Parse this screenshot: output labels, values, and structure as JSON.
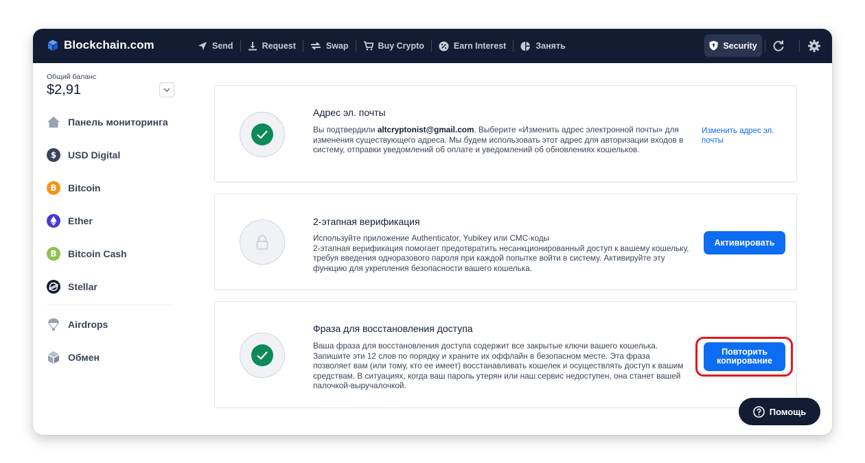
{
  "app": {
    "logo_text": "Blockchain.com"
  },
  "nav": {
    "items": [
      {
        "label": "Send",
        "icon": "send-icon"
      },
      {
        "label": "Request",
        "icon": "download-icon"
      },
      {
        "label": "Swap",
        "icon": "swap-icon"
      },
      {
        "label": "Buy Crypto",
        "icon": "cart-icon"
      },
      {
        "label": "Earn Interest",
        "icon": "percent-icon"
      },
      {
        "label": "Занять",
        "icon": "pie-icon"
      }
    ],
    "security_label": "Security"
  },
  "sidebar": {
    "balance_label": "Общий баланс",
    "balance_value": "$2,91",
    "items": [
      {
        "label": "Панель мониторинга",
        "icon": "home-icon"
      },
      {
        "label": "USD Digital",
        "icon": "usd-digital-icon"
      },
      {
        "label": "Bitcoin",
        "icon": "bitcoin-icon"
      },
      {
        "label": "Ether",
        "icon": "ether-icon"
      },
      {
        "label": "Bitcoin Cash",
        "icon": "bitcoin-cash-icon"
      },
      {
        "label": "Stellar",
        "icon": "stellar-icon"
      },
      {
        "label": "Airdrops",
        "icon": "parachute-icon"
      },
      {
        "label": "Обмен",
        "icon": "exchange-icon"
      }
    ]
  },
  "cards": {
    "email": {
      "title": "Адрес эл. почты",
      "desc_prefix": "Вы подтвердили ",
      "email": "altcryptonist@gmail.com",
      "desc_suffix": ". Выберите «Изменить адрес электронной почты» для изменения существующего адреса. Мы будем использовать этот адрес для авторизации входов в систему, отправки уведомлений об оплате и уведомлений об обновлениях кошельков.",
      "link": "Изменить адрес эл. почты",
      "status": "verified"
    },
    "two_factor": {
      "title": "2-этапная верификация",
      "desc": "Используйте приложение Authenticator, Yubikey или СМС-коды\n2-этапная верификация помогает предотвратить несанкционированный доступ к вашему кошельку, требуя введения одноразового пароля при каждой попытке войти в систему. Активируйте эту функцию для укрепления безопасности вашего кошелька.",
      "button": "Активировать",
      "status": "locked"
    },
    "recovery": {
      "title": "Фраза для восстановления доступа",
      "desc": "Ваша фраза для восстановления доступа содержит все закрытые ключи вашего кошелька. Запишите эти 12 слов по порядку и храните их оффлайн в безопасном месте. Эта фраза позволяет вам (или тому, кто ее имеет) восстанавливать кошелек и осуществлять доступ к вашим средствам.  В ситуациях, когда ваш пароль утерян или наш сервис недоступен, она станет вашей палочкой-выручалочкой.",
      "button": "Повторить копирование",
      "status": "verified"
    }
  },
  "help": {
    "label": "Помощь"
  },
  "colors": {
    "topbar": "#121d33",
    "primary": "#0c6cf2",
    "success": "#0c8a5a",
    "highlight": "#e3161e"
  }
}
